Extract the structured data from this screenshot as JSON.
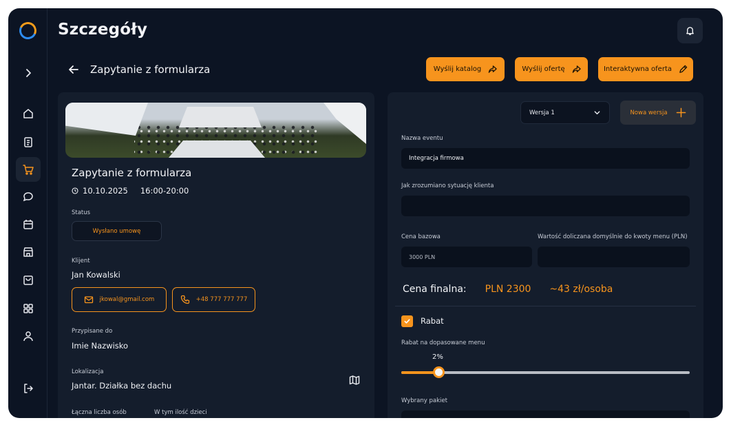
{
  "header": {
    "title": "Szczegóły"
  },
  "subheader": {
    "title": "Zapytanie z formularza"
  },
  "actions": {
    "send_catalog": "Wyślij katalog",
    "send_offer": "Wyślij ofertę",
    "interactive_offer": "Interaktywna oferta"
  },
  "sidebar": {
    "items": [
      "chevron-right-icon",
      "home-icon",
      "clipboard-icon",
      "cart-icon",
      "chat-icon",
      "calendar-icon",
      "store-icon",
      "bag-icon",
      "grid-icon",
      "user-icon",
      "logout-icon"
    ],
    "active_item": "cart-icon"
  },
  "event": {
    "title": "Zapytanie z formularza",
    "date": "10.10.2025",
    "time": "16:00-20:00",
    "status_label": "Status",
    "status_value": "Wysłano umowę",
    "client_label": "Klijent",
    "client_name": "Jan Kowalski",
    "email": "jkowal@gmail.com",
    "phone": "+48 777 777 777",
    "assigned_label": "Przypisane do",
    "assigned_value": "Imie Nazwisko",
    "location_label": "Lokalizacja",
    "location_value": "Jantar. Działka bez dachu",
    "total_people_label": "Łączna liczba osób",
    "children_label": "W tym ilość dzieci"
  },
  "offer": {
    "version_selected": "Wersja 1",
    "new_version": "Nowa wersja",
    "event_name_label": "Nazwa eventu",
    "event_name_value": "Integracja firmowa",
    "situation_label": "Jak zrozumiano sytuację klienta",
    "situation_value": "",
    "base_price_label": "Cena bazowa",
    "base_price_value": "3000 PLN",
    "default_value_label": "Wartość doliczana domyślnie do kwoty menu (PLN)",
    "default_value_value": "",
    "final_label": "Cena finalna:",
    "final_price": "PLN 2300",
    "per_person": "~43 zł/osoba",
    "discount_checked": true,
    "discount_label": "Rabat",
    "discount_menu_label": "Rabat na dopasowane menu",
    "discount_percent": "2%",
    "discount_fraction": 0.13,
    "package_label": "Wybrany pakiet"
  },
  "colors": {
    "accent": "#f7941d",
    "background": "#0c1423",
    "panel": "#141d2c"
  }
}
